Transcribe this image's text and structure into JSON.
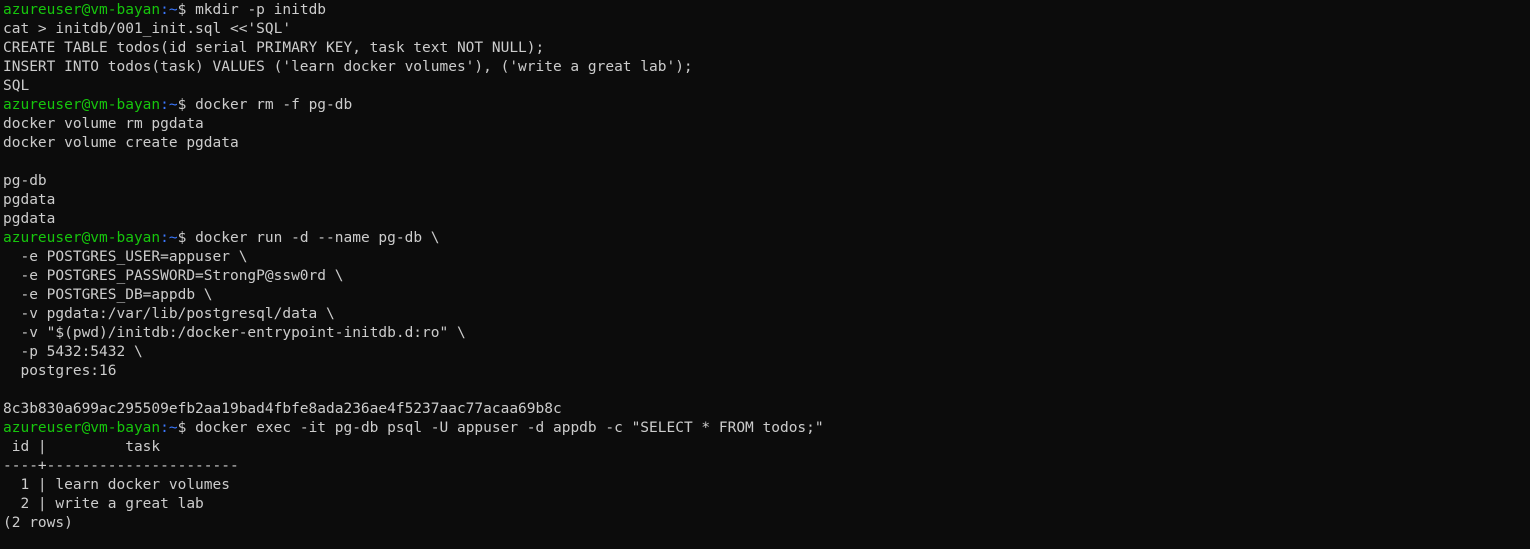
{
  "prompt": {
    "user_host": "azureuser@vm-bayan",
    "sep": ":",
    "path": "~",
    "symbol": "$ "
  },
  "lines": [
    {
      "type": "prompt",
      "text": "mkdir -p initdb"
    },
    {
      "type": "output",
      "text": "cat > initdb/001_init.sql <<'SQL'"
    },
    {
      "type": "output",
      "text": "CREATE TABLE todos(id serial PRIMARY KEY, task text NOT NULL);"
    },
    {
      "type": "output",
      "text": "INSERT INTO todos(task) VALUES ('learn docker volumes'), ('write a great lab');"
    },
    {
      "type": "output",
      "text": "SQL"
    },
    {
      "type": "prompt",
      "text": "docker rm -f pg-db"
    },
    {
      "type": "output",
      "text": "docker volume rm pgdata"
    },
    {
      "type": "output",
      "text": "docker volume create pgdata"
    },
    {
      "type": "output",
      "text": ""
    },
    {
      "type": "output",
      "text": "pg-db"
    },
    {
      "type": "output",
      "text": "pgdata"
    },
    {
      "type": "output",
      "text": "pgdata"
    },
    {
      "type": "prompt",
      "text": "docker run -d --name pg-db \\"
    },
    {
      "type": "output",
      "text": "  -e POSTGRES_USER=appuser \\"
    },
    {
      "type": "output",
      "text": "  -e POSTGRES_PASSWORD=StrongP@ssw0rd \\"
    },
    {
      "type": "output",
      "text": "  -e POSTGRES_DB=appdb \\"
    },
    {
      "type": "output",
      "text": "  -v pgdata:/var/lib/postgresql/data \\"
    },
    {
      "type": "output",
      "text": "  -v \"$(pwd)/initdb:/docker-entrypoint-initdb.d:ro\" \\"
    },
    {
      "type": "output",
      "text": "  -p 5432:5432 \\"
    },
    {
      "type": "output",
      "text": "  postgres:16"
    },
    {
      "type": "output",
      "text": ""
    },
    {
      "type": "output",
      "text": "8c3b830a699ac295509efb2aa19bad4fbfe8ada236ae4f5237aac77acaa69b8c"
    },
    {
      "type": "prompt",
      "text": "docker exec -it pg-db psql -U appuser -d appdb -c \"SELECT * FROM todos;\""
    },
    {
      "type": "output",
      "text": " id |         task"
    },
    {
      "type": "output",
      "text": "----+----------------------"
    },
    {
      "type": "output",
      "text": "  1 | learn docker volumes"
    },
    {
      "type": "output",
      "text": "  2 | write a great lab"
    },
    {
      "type": "output",
      "text": "(2 rows)"
    }
  ]
}
